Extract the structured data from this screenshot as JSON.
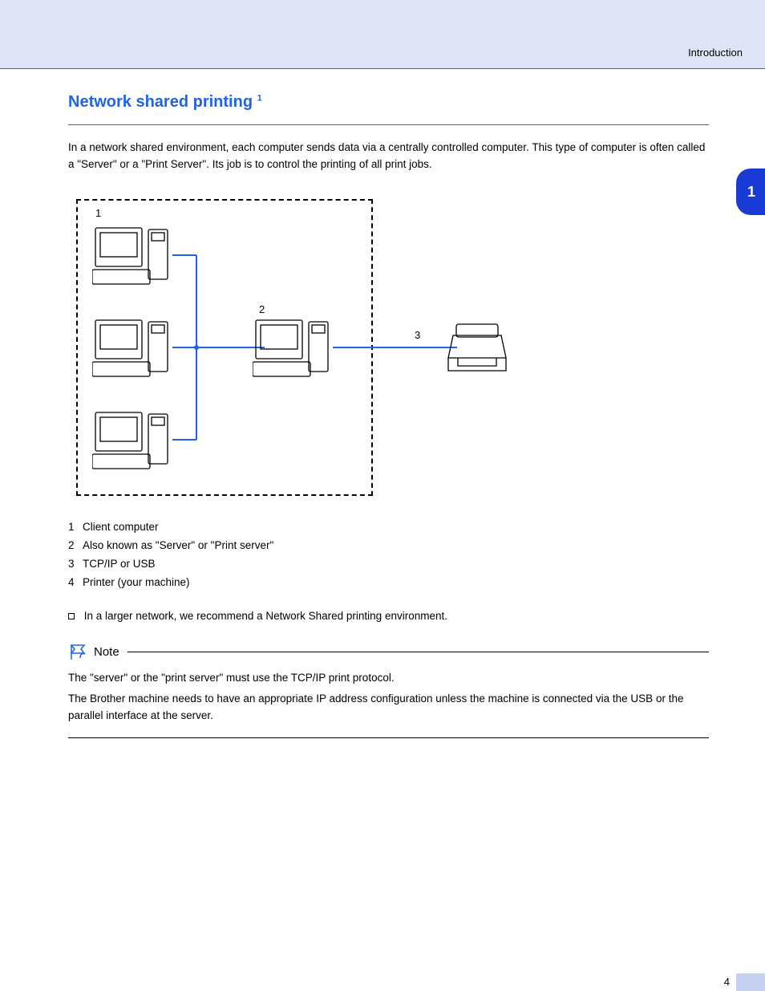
{
  "header": {
    "running_title": "Introduction"
  },
  "chapter_tab": "1",
  "section": {
    "heading": "Network shared printing",
    "sup": "1",
    "paragraph": "In a network shared environment, each computer sends data via a centrally controlled computer. This type of computer is often called a \"Server\" or a \"Print Server\". Its job is to control the printing of all print jobs."
  },
  "diagram": {
    "labels": {
      "l1": "1",
      "l2": "2",
      "l3": "3"
    }
  },
  "legend": {
    "items": [
      {
        "num": "1",
        "text": "Client computer"
      },
      {
        "num": "2",
        "text": "Also known as \"Server\" or \"Print server\""
      },
      {
        "num": "3",
        "text": "TCP/IP or USB"
      },
      {
        "num": "4",
        "text": "Printer (your machine)"
      }
    ]
  },
  "bullet": "In a larger network, we recommend a Network Shared printing environment.",
  "note": {
    "label": "Note",
    "text_pre": "The \"server\" or the \"print server\" must use the TCP/IP print protocol.",
    "text_post": "The Brother machine needs to have an appropriate IP address configuration unless the machine is connected via the USB or the parallel interface at the server."
  },
  "page_number": "4"
}
